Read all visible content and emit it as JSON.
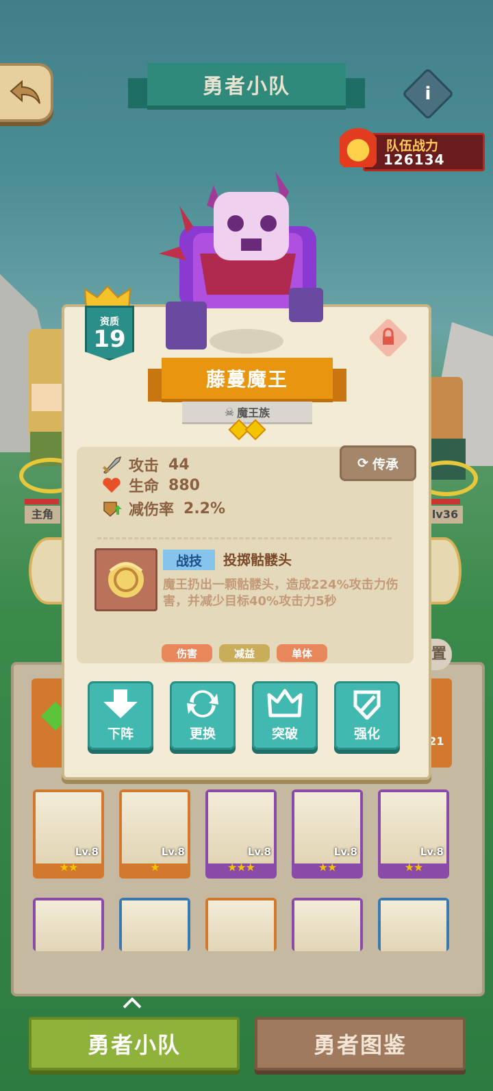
{
  "header": {
    "title": "勇者小队",
    "back_icon": "back-arrow-icon",
    "info_icon": "i"
  },
  "team_power": {
    "label": "队伍战力",
    "value": "126134"
  },
  "side_heroes": {
    "left_label": "主角",
    "right_level": "lv36"
  },
  "card": {
    "quality_label": "资质",
    "quality_value": "19",
    "name": "藤蔓魔王",
    "race": "魔王族",
    "diamond_stars": 2,
    "inherit_label": "传承",
    "stats": [
      {
        "icon": "sword-icon",
        "label": "攻击",
        "value": "44"
      },
      {
        "icon": "heart-icon",
        "label": "生命",
        "value": "880"
      },
      {
        "icon": "shield-icon",
        "label": "减伤率",
        "value": "2.2%"
      }
    ],
    "skill": {
      "type": "战技",
      "name": "投掷骷髅头",
      "description": "魔王扔出一颗骷髅头，造成224%攻击力伤害，并减少目标40%攻击力5秒",
      "tags": [
        "伤害",
        "减益",
        "单体"
      ]
    },
    "actions": [
      "下阵",
      "更换",
      "突破",
      "强化"
    ]
  },
  "list_partial_labels": {
    "peek_button": "置",
    "peek_level": ".21"
  },
  "heroes_row1": [
    {
      "level": "Lv.8",
      "stars": 2,
      "frame": "#d2792d"
    },
    {
      "level": "Lv.8",
      "stars": 1,
      "frame": "#d2792d"
    },
    {
      "level": "Lv.8",
      "stars": 3,
      "frame": "#8a4aa8"
    },
    {
      "level": "Lv.8",
      "stars": 2,
      "frame": "#8a4aa8"
    },
    {
      "level": "Lv.8",
      "stars": 2,
      "frame": "#8a4aa8"
    }
  ],
  "heroes_row2_frames": [
    "#8a4aa8",
    "#3a78b0",
    "#d2792d",
    "#8a4aa8",
    "#3a78b0"
  ],
  "bottom_tabs": {
    "active": "勇者小队",
    "inactive": "勇者图鉴"
  }
}
